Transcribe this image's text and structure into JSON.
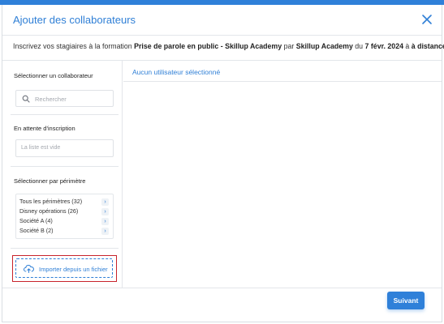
{
  "modal": {
    "title": "Ajouter des collaborateurs",
    "subtitle": {
      "prefix": "Inscrivez vos stagiaires à la formation ",
      "course": "Prise de parole en public - Skillup Academy",
      "by": " par ",
      "organizer": "Skillup Academy",
      "on": " du ",
      "date": "7 févr. 2024",
      "at": " à ",
      "mode": "à distance",
      "suffix": "."
    }
  },
  "left": {
    "select_label": "Sélectionner un collaborateur",
    "search_placeholder": "Rechercher",
    "pending_label": "En attente d'inscription",
    "pending_empty": "La liste est vide",
    "scope_label": "Sélectionner par périmètre",
    "scopes": [
      {
        "label": "Tous les périmètres (32)"
      },
      {
        "label": "Disney opérations (26)"
      },
      {
        "label": "Société A (4)"
      },
      {
        "label": "Société B (2)"
      }
    ],
    "import_label": "Importer depuis un fichier"
  },
  "right": {
    "header": "Aucun utilisateur sélectionné"
  },
  "footer": {
    "next_label": "Suivant"
  },
  "colors": {
    "accent": "#2f80d9",
    "highlight_border": "#c8232c"
  },
  "icons": [
    "close-icon",
    "search-icon",
    "chevron-right-icon",
    "cloud-upload-icon"
  ]
}
